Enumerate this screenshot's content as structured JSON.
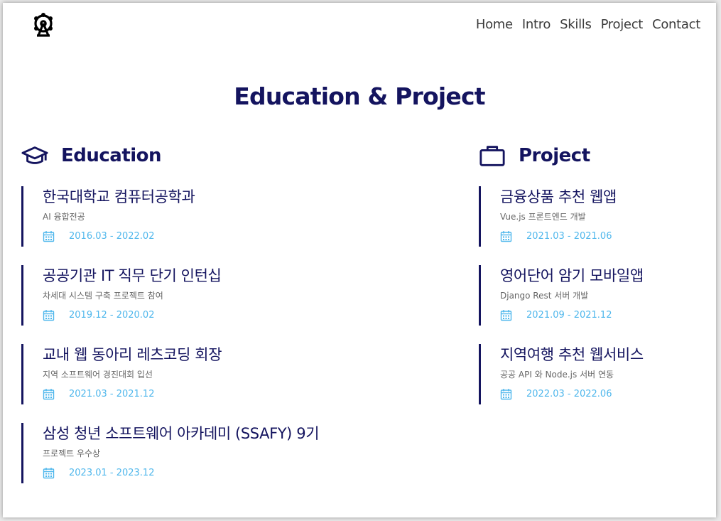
{
  "header": {
    "logo_icon": "ferris-wheel-icon",
    "nav": [
      "Home",
      "Intro",
      "Skills",
      "Project",
      "Contact"
    ]
  },
  "page_title": "Education & Project",
  "education": {
    "heading": "Education",
    "icon": "graduation-cap-icon",
    "items": [
      {
        "title": "한국대학교 컴퓨터공학과",
        "subtitle": "AI 융합전공",
        "period": "2016.03 - 2022.02"
      },
      {
        "title": "공공기관 IT 직무 단기 인턴십",
        "subtitle": "차세대 시스템 구축 프로젝트 참여",
        "period": "2019.12 - 2020.02"
      },
      {
        "title": "교내 웹 동아리 레츠코딩 회장",
        "subtitle": "지역 소프트웨어 경진대회 입선",
        "period": "2021.03 - 2021.12"
      },
      {
        "title": "삼성 청년 소프트웨어 아카데미 (SSAFY) 9기",
        "subtitle": "프로젝트 우수상",
        "period": "2023.01 - 2023.12"
      }
    ]
  },
  "project": {
    "heading": "Project",
    "icon": "briefcase-icon",
    "items": [
      {
        "title": "금융상품 추천 웹앱",
        "subtitle": "Vue.js 프론트엔드 개발",
        "period": "2021.03 - 2021.06"
      },
      {
        "title": "영어단어 암기 모바일앱",
        "subtitle": "Django Rest 서버 개발",
        "period": "2021.09 - 2021.12"
      },
      {
        "title": "지역여행 추천 웹서비스",
        "subtitle": "공공 API 와 Node.js 서버 연동",
        "period": "2022.03 - 2022.06"
      }
    ]
  },
  "colors": {
    "navy": "#14145f",
    "date_blue": "#4fb7ec",
    "muted": "#666666"
  }
}
